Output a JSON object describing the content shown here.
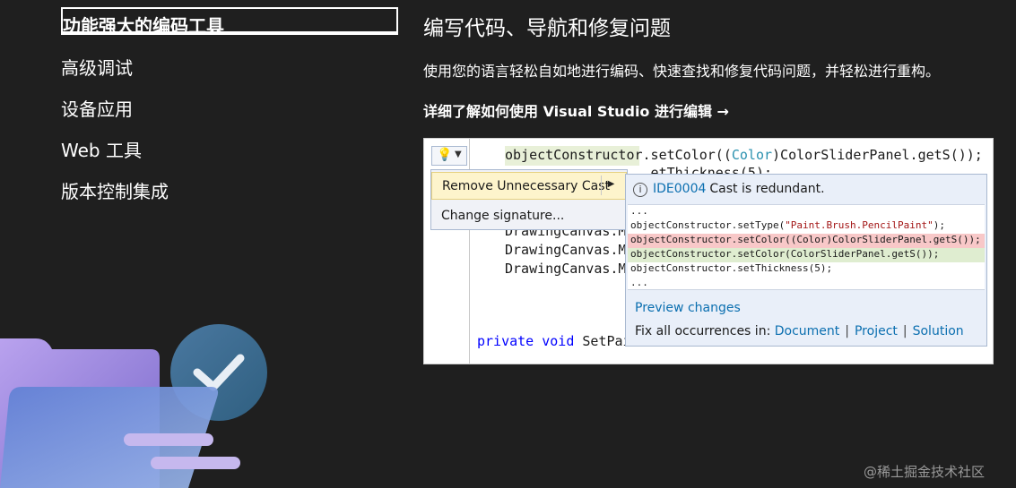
{
  "nav": {
    "items": [
      {
        "label": "功能强大的编码工具"
      },
      {
        "label": "高级调试"
      },
      {
        "label": "设备应用"
      },
      {
        "label": "Web 工具"
      },
      {
        "label": "版本控制集成"
      }
    ]
  },
  "content": {
    "headline": "编写代码、导航和修复问题",
    "description": "使用您的语言轻松自如地进行编码、快速查找和修复代码问题，并轻松进行重构。",
    "learn_more": "详细了解如何使用 Visual Studio 进行编辑 →"
  },
  "editor": {
    "line1": {
      "a": "objectConstructor.setColor((",
      "b": "Color",
      "c": ")ColorSliderPanel.getS());"
    },
    "line2": "                  etThickness(5);",
    "canvas_lines": [
      "DrawingCanvas.M",
      "DrawingCanvas.M",
      "DrawingCanvas.M"
    ],
    "private_kw": "private void",
    "private_rest": " SetPai",
    "bulb_icon": "lightbulb-icon",
    "quick_actions": {
      "items": [
        {
          "label": "Remove Unnecessary Cast"
        },
        {
          "label": "Change signature..."
        }
      ],
      "submenu_icon": "chevron-right-icon"
    },
    "tooltip": {
      "code_id": "IDE0004",
      "message": "Cast is redundant.",
      "diff": [
        {
          "text": "..."
        },
        {
          "a": "objectConstructor.setType(",
          "s": "\"Paint.Brush.PencilPaint\"",
          "b": ");"
        },
        {
          "text": "objectConstructor.setColor((Color)ColorSliderPanel.getS());"
        },
        {
          "text": "objectConstructor.setColor(ColorSliderPanel.getS());"
        },
        {
          "text": "objectConstructor.setThickness(5);"
        },
        {
          "text": "..."
        }
      ],
      "preview_label": "Preview changes",
      "fix_all_label": "Fix all occurrences in:",
      "scope_document": "Document",
      "scope_project": "Project",
      "scope_solution": "Solution",
      "separator": "|"
    }
  },
  "watermark": "@稀土掘金技术社区",
  "colors": {
    "background": "#1f1f1f",
    "folder": "#a98fe0",
    "check_circle": "#3b6e8c",
    "link_blue": "#0b6fb0"
  }
}
